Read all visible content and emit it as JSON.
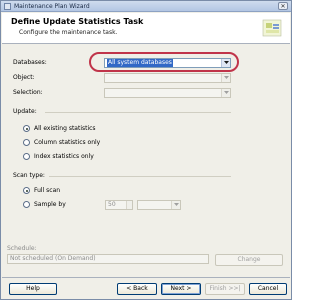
{
  "window": {
    "title": "Maintenance Plan Wizard",
    "close_glyph": "✕"
  },
  "header": {
    "title": "Define Update Statistics Task",
    "subtitle": "Configure the maintenance task."
  },
  "form": {
    "databases_label": "Databases:",
    "databases_value": "All system databases",
    "object_label": "Object:",
    "selection_label": "Selection:"
  },
  "update": {
    "section_label": "Update:",
    "options": [
      "All existing statistics",
      "Column statistics only",
      "Index statistics only"
    ],
    "selected_index": 0
  },
  "scan": {
    "section_label": "Scan type:",
    "options": [
      "Full scan",
      "Sample by"
    ],
    "selected_index": 0,
    "sample_value": "50"
  },
  "schedule": {
    "label": "Schedule:",
    "value": "Not scheduled (On Demand)",
    "change_label": "Change"
  },
  "footer": {
    "help_label": "Help",
    "back_label": "< Back",
    "next_label": "Next >",
    "finish_label": "Finish >>|",
    "cancel_label": "Cancel"
  },
  "colors": {
    "highlight_ring": "#c0344a",
    "selection": "#3168c6"
  }
}
